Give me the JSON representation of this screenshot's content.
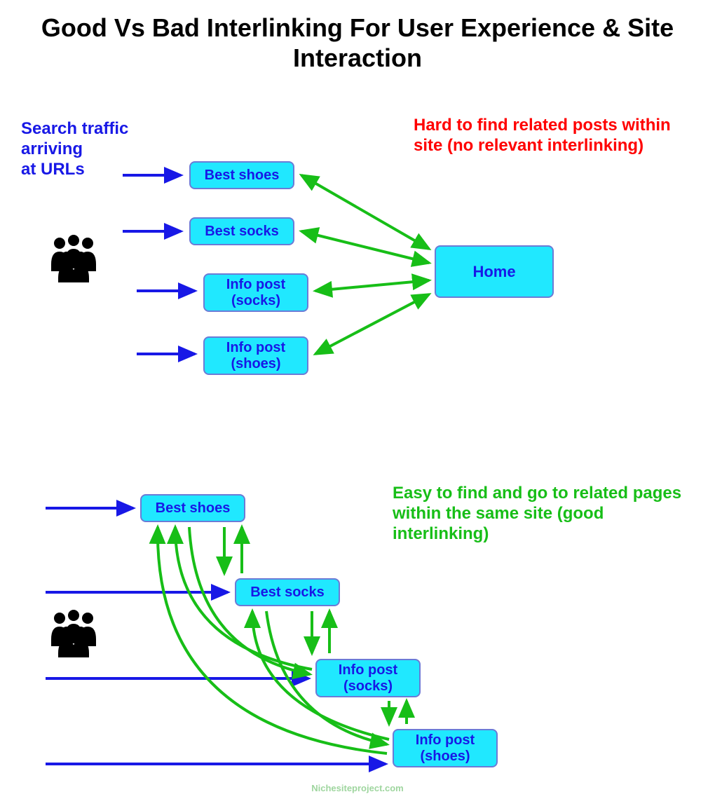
{
  "title": "Good Vs Bad Interlinking For User Experience & Site Interaction",
  "labels": {
    "traffic": "Search traffic\narriving\nat URLs",
    "bad": "Hard to find related posts within site (no relevant interlinking)",
    "good": "Easy to find and go to related pages within the same site (good interlinking)"
  },
  "bad_section": {
    "nodes": [
      {
        "id": "bad-shoes",
        "label": "Best shoes"
      },
      {
        "id": "bad-socks",
        "label": "Best socks"
      },
      {
        "id": "bad-info-socks",
        "label": "Info post\n(socks)"
      },
      {
        "id": "bad-info-shoes",
        "label": "Info post\n(shoes)"
      }
    ],
    "home": "Home"
  },
  "good_section": {
    "nodes": [
      {
        "id": "good-shoes",
        "label": "Best shoes"
      },
      {
        "id": "good-socks",
        "label": "Best socks"
      },
      {
        "id": "good-info-socks",
        "label": "Info post\n(socks)"
      },
      {
        "id": "good-info-shoes",
        "label": "Info post\n(shoes)"
      }
    ]
  },
  "footer": "Nichesiteproject.com",
  "colors": {
    "blue": "#1818e6",
    "green_arrow": "#17be17",
    "red": "#ff0000",
    "cyan": "#20e8ff"
  }
}
